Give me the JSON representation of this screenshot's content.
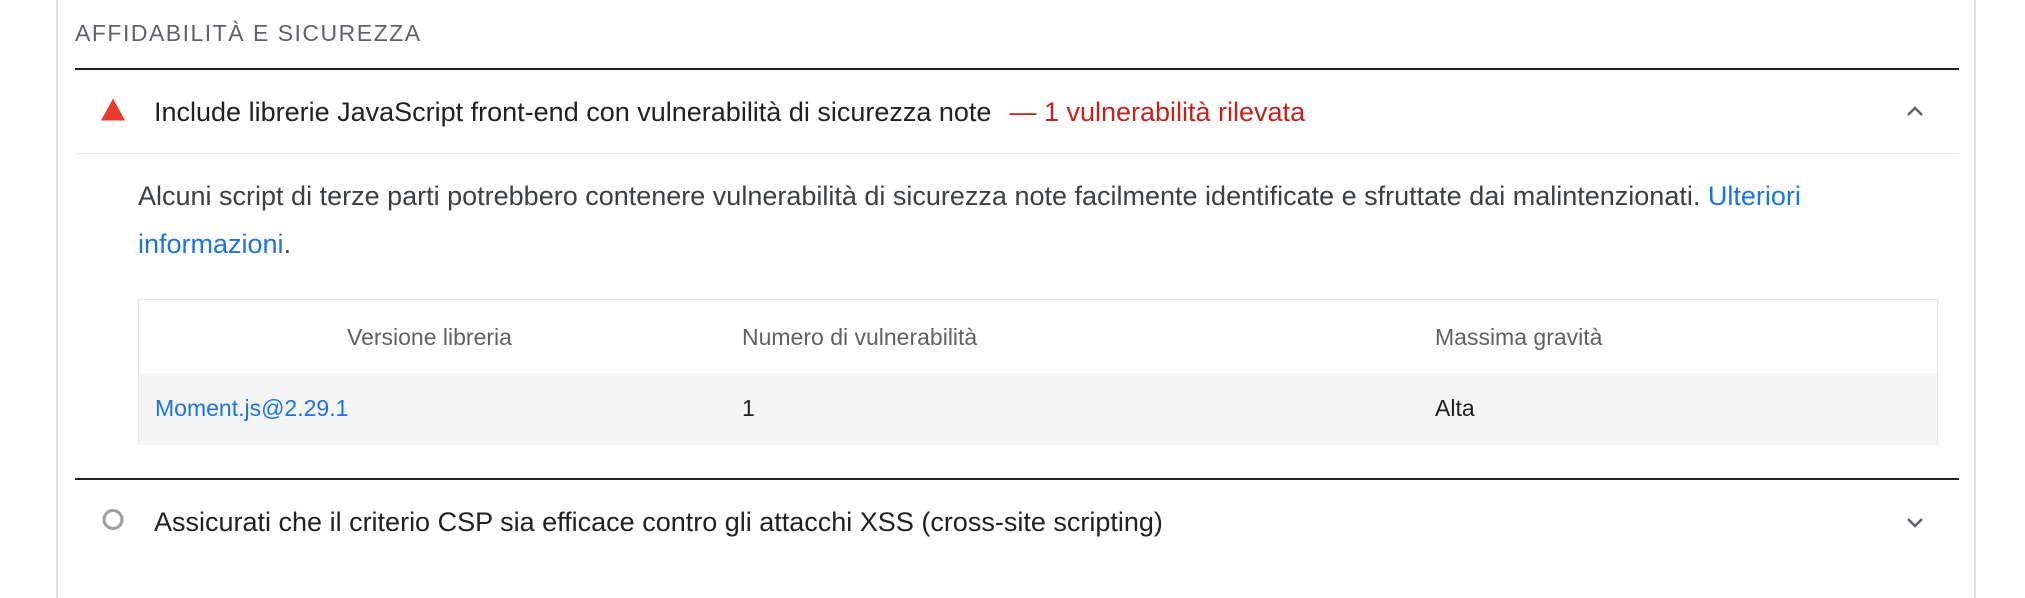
{
  "section": {
    "title": "AFFIDABILITÀ E SICUREZZA"
  },
  "audits": [
    {
      "status": "fail",
      "status_icon": "red-triangle-icon",
      "title": "Include librerie JavaScript front-end con vulnerabilità di sicurezza note",
      "display_value": "— 1 vulnerabilità rilevata",
      "expanded": true,
      "description": "Alcuni script di terze parti potrebbero contenere vulnerabilità di sicurezza note facilmente identificate e sfruttate dai malintenzionati.",
      "learn_more_label": "Ulteriori informazioni",
      "description_end": ".",
      "table": {
        "headers": [
          "Versione libreria",
          "Numero di vulnerabilità",
          "Massima gravità"
        ],
        "rows": [
          [
            "Moment.js@2.29.1",
            "1",
            "Alta"
          ]
        ]
      }
    },
    {
      "status": "neutral",
      "status_icon": "grey-circle-icon",
      "title": "Assicurati che il criterio CSP sia efficace contro gli attacchi XSS (cross-site scripting)",
      "expanded": false
    }
  ],
  "colors": {
    "fail": "#eb3b2f",
    "fail_text": "#c5221f",
    "link": "#1a73e8",
    "neutral": "#9e9e9e"
  }
}
